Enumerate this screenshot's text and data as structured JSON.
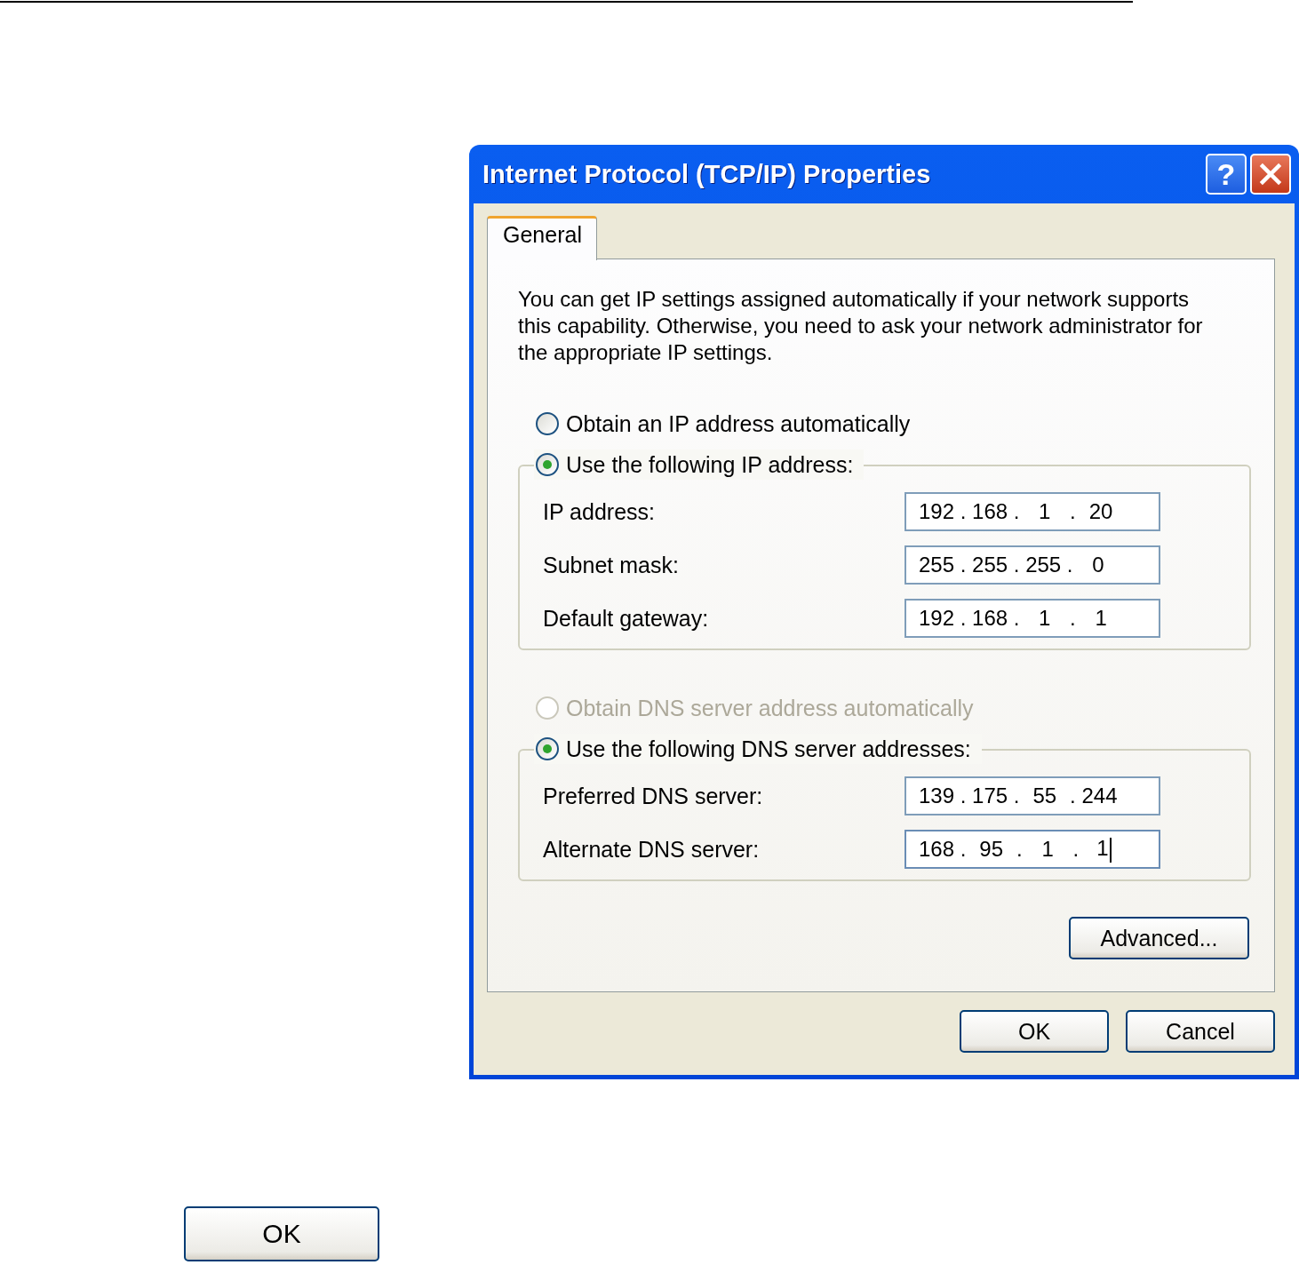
{
  "window": {
    "title": "Internet Protocol (TCP/IP) Properties",
    "help_button": "?"
  },
  "tabs": [
    {
      "label": "General",
      "selected": true
    }
  ],
  "description": "You can get IP settings assigned automatically if your network supports this capability. Otherwise, you need to ask your network administrator for the appropriate IP settings.",
  "sections": [
    {
      "options": [
        {
          "label": "Obtain an IP address automatically",
          "selected": false,
          "disabled": false
        },
        {
          "label": "Use the following IP address:",
          "selected": true,
          "disabled": false
        }
      ],
      "fields": [
        {
          "label": "IP address:",
          "value": "192 . 168 .  1  .  20",
          "focused": false
        },
        {
          "label": "Subnet mask:",
          "value": "255 . 255 . 255 .  0",
          "focused": false
        },
        {
          "label": "Default gateway:",
          "value": "192 . 168 .  1  .  1",
          "focused": false
        }
      ]
    },
    {
      "options": [
        {
          "label": "Obtain DNS server address automatically",
          "selected": false,
          "disabled": true
        },
        {
          "label": "Use the following DNS server addresses:",
          "selected": true,
          "disabled": false
        }
      ],
      "fields": [
        {
          "label": "Preferred DNS server:",
          "value": "139 . 175 .  55  . 244",
          "focused": false
        },
        {
          "label": "Alternate DNS server:",
          "value": "168 .  95  .  1  .  1",
          "focused": true
        }
      ]
    }
  ],
  "advanced_button": "Advanced...",
  "buttons": [
    "OK",
    "Cancel"
  ],
  "page_button": "OK"
}
